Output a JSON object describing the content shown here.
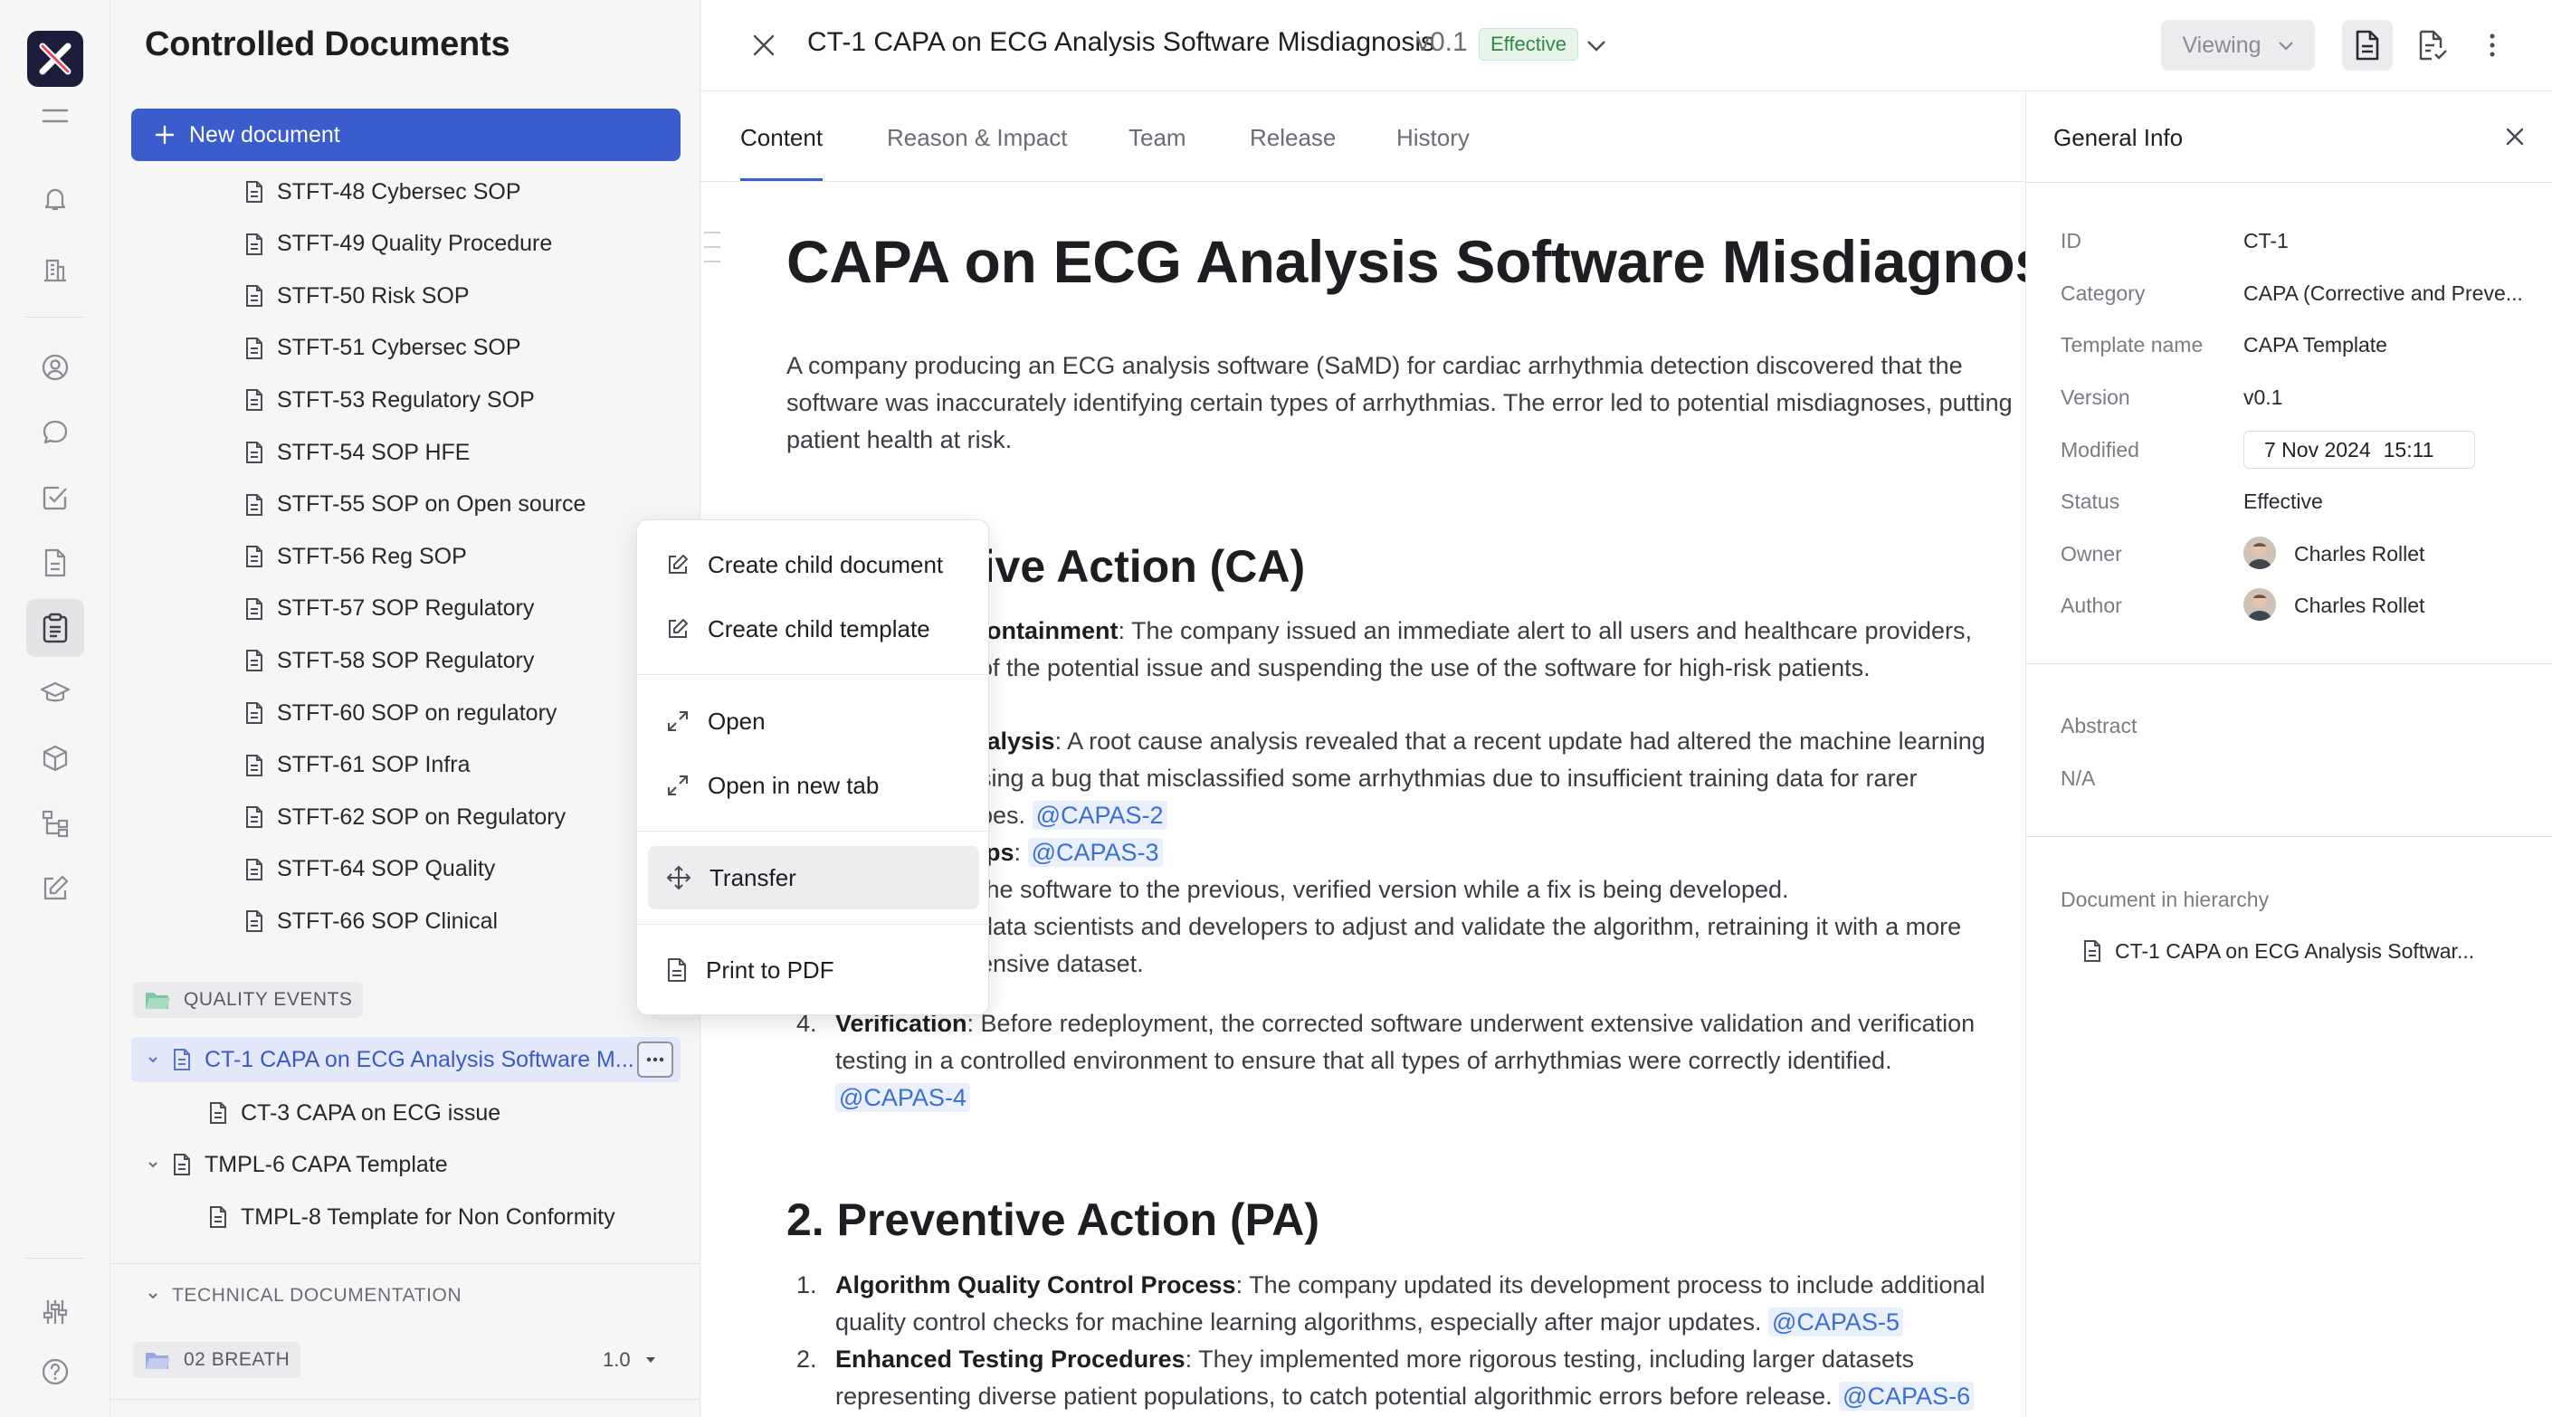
{
  "sidebar": {
    "title": "Controlled Documents",
    "new_document": "New document",
    "docs": [
      "STFT-48 Cybersec SOP",
      "STFT-49 Quality Procedure",
      "STFT-50 Risk SOP",
      "STFT-51 Cybersec SOP",
      "STFT-53 Regulatory SOP",
      "STFT-54 SOP HFE",
      "STFT-55 SOP on Open source",
      "STFT-56 Reg SOP",
      "STFT-57 SOP Regulatory",
      "STFT-58 SOP Regulatory",
      "STFT-60 SOP on regulatory",
      "STFT-61 SOP Infra",
      "STFT-62 SOP on Regulatory",
      "STFT-64 SOP Quality",
      "STFT-66 SOP Clinical"
    ],
    "quality_events_folder": "QUALITY EVENTS",
    "quality_items": [
      "CT-1 CAPA on ECG Analysis Software M...",
      "CT-3 CAPA on ECG issue",
      "TMPL-6 CAPA Template",
      "TMPL-8 Template for Non Conformity"
    ],
    "technical_documentation": "TECHNICAL DOCUMENTATION",
    "breath_folder": "02 BREATH",
    "breath_version": "1.0"
  },
  "header": {
    "title": "CT-1 CAPA on ECG Analysis Software Misdiagnosis",
    "version": "v0.1",
    "status": "Effective",
    "viewing": "Viewing"
  },
  "tabs": [
    "Content",
    "Reason & Impact",
    "Team",
    "Release",
    "History"
  ],
  "document": {
    "heading": "CAPA on ECG Analysis Software Misdiagnosis",
    "intro": "A company producing an ECG analysis software (SaMD) for cardiac arrhythmia detection discovered that the software was inaccurately identifying certain types of arrhythmias. The error led to potential misdiagnoses, putting patient health at risk.",
    "ca_heading_visible": "tive Action (CA)",
    "ca1_bold": "ontainment",
    "ca1_line1": ": The company issued an immediate alert to all users and healthcare providers,",
    "ca1_line2": "of the potential issue and suspending the use of the software for high-risk patients.",
    "ca2_bold": "nalysis",
    "ca2_line1": ": A root cause analysis revealed that a recent update had altered the machine learning",
    "ca2_line2": "sing a bug that misclassified some arrhythmias due to insufficient training data for rarer",
    "ca2_line3": "pes.",
    "mention_2": "@CAPAS-2",
    "ca3_bold": "eps",
    "ca3_colon": ":",
    "mention_3": "@CAPAS-3",
    "ca3_line1": "the software to the previous, verified version while a fix is being developed.",
    "ca3_line2": "data scientists and developers to adjust and validate the algorithm, retraining it with a more",
    "ca3_line3": "ensive dataset.",
    "ca4_num": "4.",
    "ca4_bold": "Verification",
    "ca4_line1": ": Before redeployment, the corrected software underwent extensive validation and verification",
    "ca4_line2": "testing in a controlled environment to ensure that all types of arrhythmias were correctly identified.",
    "mention_4": "@CAPAS-4",
    "pa_heading": "2. Preventive Action (PA)",
    "pa1_num": "1.",
    "pa1_bold": "Algorithm Quality Control Process",
    "pa1_line1": ": The company updated its development process to include additional",
    "pa1_line2": "quality control checks for machine learning algorithms, especially after major updates.",
    "mention_5": "@CAPAS-5",
    "pa2_num": "2.",
    "pa2_bold": "Enhanced Testing Procedures",
    "pa2_line1": ": They implemented more rigorous testing, including larger datasets",
    "pa2_line2": "representing diverse patient populations, to catch potential algorithmic errors before release.",
    "mention_6": "@CAPAS-6"
  },
  "panel": {
    "title": "General Info",
    "id_label": "ID",
    "id_value": "CT-1",
    "category_label": "Category",
    "category_value": "CAPA (Corrective and Preve...",
    "template_label": "Template name",
    "template_value": "CAPA Template",
    "version_label": "Version",
    "version_value": "v0.1",
    "modified_label": "Modified",
    "modified_date": "7 Nov 2024",
    "modified_time": "15:11",
    "status_label": "Status",
    "status_value": "Effective",
    "owner_label": "Owner",
    "owner_value": "Charles Rollet",
    "author_label": "Author",
    "author_value": "Charles Rollet",
    "abstract_label": "Abstract",
    "abstract_value": "N/A",
    "hierarchy_label": "Document in hierarchy",
    "hierarchy_value": "CT-1 CAPA on ECG Analysis Softwar..."
  },
  "context_menu": {
    "create_child_document": "Create child document",
    "create_child_template": "Create child template",
    "open": "Open",
    "open_new_tab": "Open in new tab",
    "transfer": "Transfer",
    "print_pdf": "Print to PDF"
  },
  "colors": {
    "accent": "#3a5ccc",
    "status_green": "#2f8a45",
    "mention": "#3a6fd6"
  }
}
